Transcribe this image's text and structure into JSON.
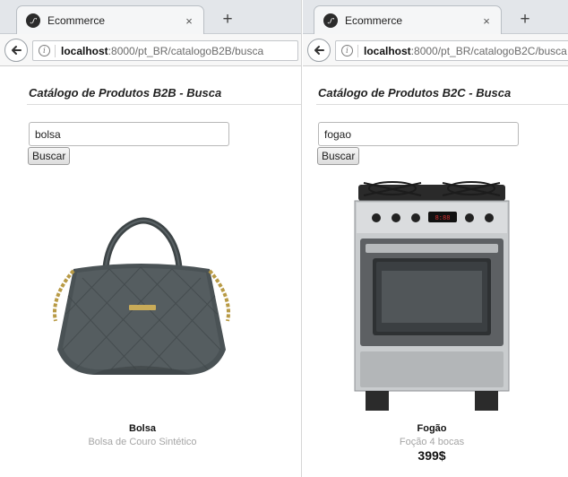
{
  "windows": [
    {
      "tab": {
        "title": "Ecommerce",
        "close_label": "×",
        "new_tab_label": "+"
      },
      "address": {
        "host": "localhost",
        "path": ":8000/pt_BR/catalogoB2B/busca"
      },
      "page": {
        "title": "Catálogo de Produtos B2B - Busca",
        "search_value": "bolsa",
        "search_button": "Buscar",
        "product": {
          "name": "Bolsa",
          "description": "Bolsa de Couro Sintético",
          "image_icon": "handbag-image"
        }
      }
    },
    {
      "tab": {
        "title": "Ecommerce",
        "close_label": "×",
        "new_tab_label": "+"
      },
      "address": {
        "host": "localhost",
        "path": ":8000/pt_BR/catalogoB2C/busca"
      },
      "page": {
        "title": "Catálogo de Produtos B2C - Busca",
        "search_value": "fogao",
        "search_button": "Buscar",
        "product": {
          "name": "Fogão",
          "description": "Foção 4 bocas",
          "price": "399$",
          "image_icon": "stove-image"
        }
      }
    }
  ],
  "colors": {
    "tab_bg": "#f5f6f7",
    "tabstrip_bg": "#e3e6ea",
    "navbar_bg": "#f7f7f7",
    "muted_text": "#a5a5a5"
  },
  "icons": [
    "symfony-favicon-icon",
    "back-arrow-icon",
    "info-icon",
    "close-icon",
    "plus-icon"
  ]
}
